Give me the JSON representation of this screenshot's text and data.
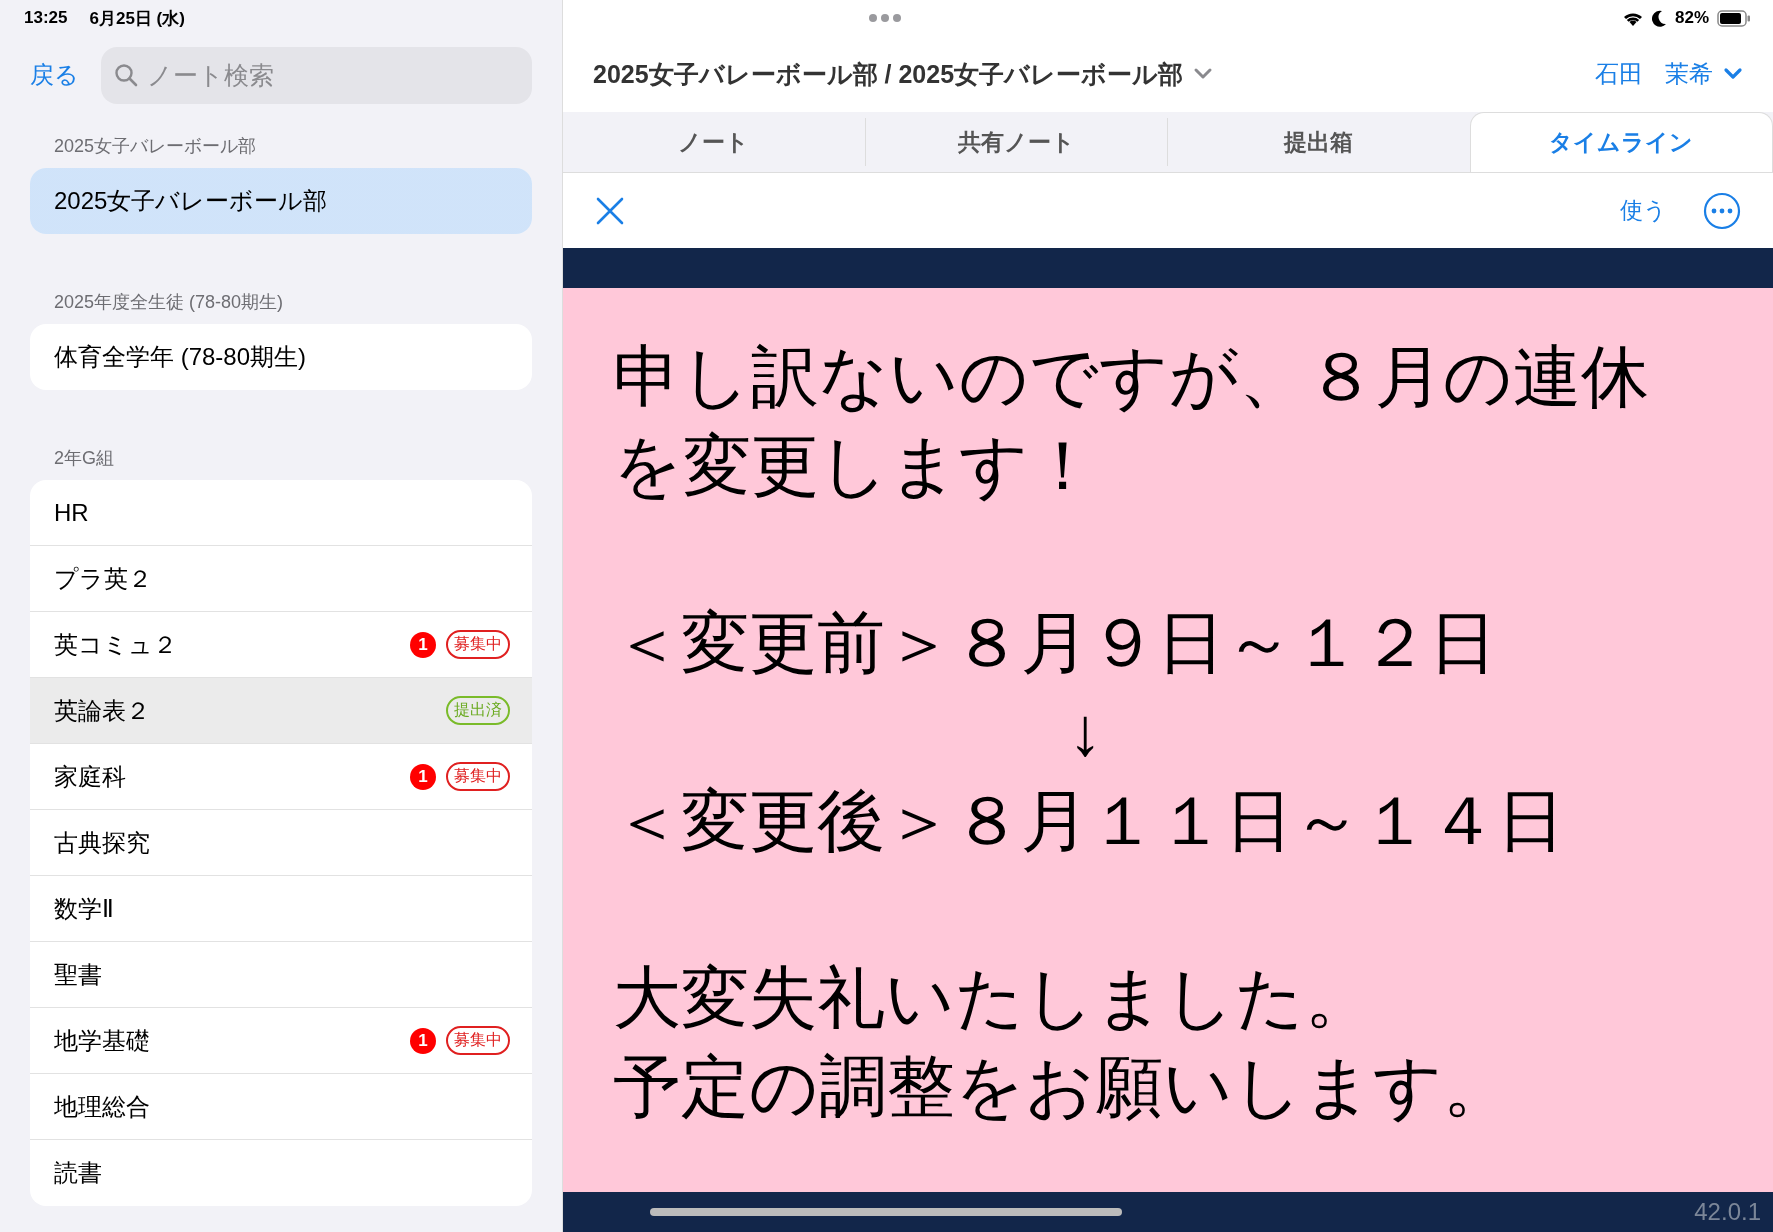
{
  "status_bar": {
    "time": "13:25",
    "date": "6月25日 (水)",
    "battery": "82%"
  },
  "sidebar": {
    "back": "戻る",
    "search": {
      "placeholder": "ノート検索"
    },
    "groups": [
      {
        "title": "2025女子バレーボール部",
        "items": [
          {
            "label": "2025女子バレーボール部",
            "selected": true,
            "highlighted": false
          }
        ]
      },
      {
        "title": "2025年度全生徒 (78-80期生)",
        "items": [
          {
            "label": "体育全学年 (78-80期生)",
            "selected": false,
            "highlighted": false
          }
        ]
      },
      {
        "title": "2年G組",
        "items": [
          {
            "label": "HR",
            "selected": false,
            "highlighted": false
          },
          {
            "label": "プラ英２",
            "selected": false,
            "highlighted": false
          },
          {
            "label": "英コミュ２",
            "selected": false,
            "highlighted": false,
            "count": "1",
            "tag": {
              "text": "募集中",
              "kind": "open"
            }
          },
          {
            "label": "英論表２",
            "selected": false,
            "highlighted": true,
            "tag": {
              "text": "提出済",
              "kind": "done"
            }
          },
          {
            "label": "家庭科",
            "selected": false,
            "highlighted": false,
            "count": "1",
            "tag": {
              "text": "募集中",
              "kind": "open"
            }
          },
          {
            "label": "古典探究",
            "selected": false,
            "highlighted": false
          },
          {
            "label": "数学Ⅱ",
            "selected": false,
            "highlighted": false
          },
          {
            "label": "聖書",
            "selected": false,
            "highlighted": false
          },
          {
            "label": "地学基礎",
            "selected": false,
            "highlighted": false,
            "count": "1",
            "tag": {
              "text": "募集中",
              "kind": "open"
            }
          },
          {
            "label": "地理総合",
            "selected": false,
            "highlighted": false
          },
          {
            "label": "読書",
            "selected": false,
            "highlighted": false
          }
        ]
      }
    ]
  },
  "header": {
    "title": "2025女子バレーボール部 / 2025女子バレーボール部",
    "user_last": "石田",
    "user_first": "茉希"
  },
  "tabs": [
    {
      "label": "ノート",
      "selected": false
    },
    {
      "label": "共有ノート",
      "selected": false
    },
    {
      "label": "提出箱",
      "selected": false
    },
    {
      "label": "タイムライン",
      "selected": true
    }
  ],
  "toolbar": {
    "use": "使う"
  },
  "note": {
    "paragraphs": [
      [
        {
          "text": "申し訳ないのですが、８月の連休",
          "kind": "text"
        },
        {
          "text": "を変更します！",
          "kind": "text"
        }
      ],
      [
        {
          "text": "＜変更前＞８月９日～１２日",
          "kind": "text"
        },
        {
          "text": "↓",
          "kind": "arrow"
        },
        {
          "text": "＜変更後＞８月１１日～１４日",
          "kind": "text"
        }
      ],
      [
        {
          "text": "大変失礼いたしました。",
          "kind": "text"
        },
        {
          "text": "予定の調整をお願いします。",
          "kind": "text"
        }
      ]
    ]
  },
  "version": "42.0.1"
}
